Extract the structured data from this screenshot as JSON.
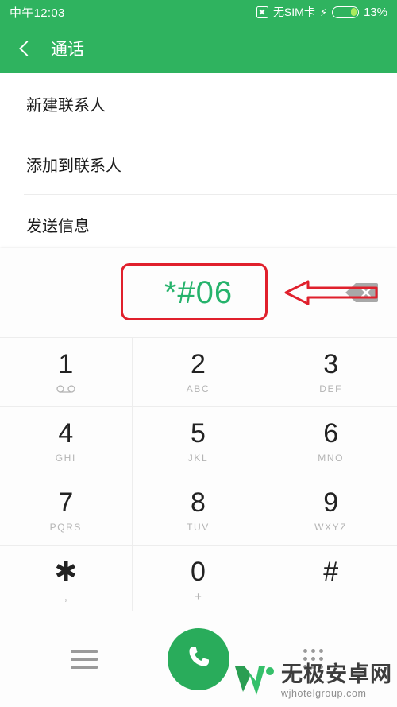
{
  "status_bar": {
    "time": "中午12:03",
    "sim_text": "无SIM卡",
    "battery_percent": "13%",
    "charging_glyph": "⚡",
    "battery_level": 13
  },
  "app_bar": {
    "title": "通话",
    "back_label": "返回"
  },
  "menu": {
    "items": [
      {
        "label": "新建联系人"
      },
      {
        "label": "添加到联系人"
      },
      {
        "label": "发送信息"
      }
    ]
  },
  "dialer": {
    "dialed_number": "*#06",
    "backspace_label": "删除",
    "keys": [
      {
        "digit": "1",
        "sub": "",
        "icon": "voicemail-icon"
      },
      {
        "digit": "2",
        "sub": "ABC",
        "icon": ""
      },
      {
        "digit": "3",
        "sub": "DEF",
        "icon": ""
      },
      {
        "digit": "4",
        "sub": "GHI",
        "icon": ""
      },
      {
        "digit": "5",
        "sub": "JKL",
        "icon": ""
      },
      {
        "digit": "6",
        "sub": "MNO",
        "icon": ""
      },
      {
        "digit": "7",
        "sub": "PQRS",
        "icon": ""
      },
      {
        "digit": "8",
        "sub": "TUV",
        "icon": ""
      },
      {
        "digit": "9",
        "sub": "WXYZ",
        "icon": ""
      },
      {
        "digit": "✱",
        "sub": ",",
        "icon": ""
      },
      {
        "digit": "0",
        "sub": "+",
        "icon": ""
      },
      {
        "digit": "#",
        "sub": "",
        "icon": ""
      }
    ]
  },
  "bottom_bar": {
    "menu_label": "菜单",
    "call_label": "拨号",
    "keypad_label": "键盘"
  },
  "annotation": {
    "highlight_target": "*#06",
    "arrow_direction": "left",
    "color": "#e0202c"
  },
  "watermark": {
    "site_name": "无极安卓网",
    "url": "wjhotelgroup.com"
  },
  "colors": {
    "brand_green": "#2fb35f",
    "number_green": "#26b36c",
    "call_green": "#29ac5b",
    "annotation_red": "#e0202c"
  }
}
